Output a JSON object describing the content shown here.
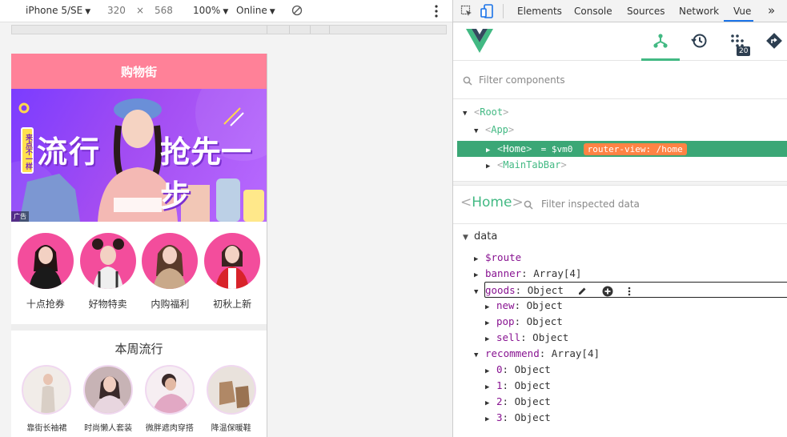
{
  "device_toolbar": {
    "device": "iPhone 5/SE",
    "width": "320",
    "times": "×",
    "height": "568",
    "zoom": "100%",
    "network": "Online"
  },
  "phone": {
    "nav_title": "购物街",
    "banner": {
      "tag": "来点不一样",
      "left_text": "流行",
      "right_text": "抢先一步",
      "ad_label": "广告"
    },
    "recommend": [
      {
        "label": "十点抢券"
      },
      {
        "label": "好物特卖"
      },
      {
        "label": "内购福利"
      },
      {
        "label": "初秋上新"
      }
    ],
    "weekly_title": "本周流行",
    "weekly": [
      {
        "label": "靠街长袖裙"
      },
      {
        "label": "时尚懒人套装"
      },
      {
        "label": "微胖遮肉穿搭"
      },
      {
        "label": "降温保暖鞋"
      }
    ]
  },
  "devtools": {
    "tabs": [
      "Elements",
      "Console",
      "Sources",
      "Network",
      "Vue"
    ],
    "active_tab": "Vue",
    "more": "»",
    "vue_toolbar": {
      "badge": "20"
    },
    "filter_components_placeholder": "Filter components",
    "tree": {
      "root": "Root",
      "app": "App",
      "home": "Home",
      "home_suffix": "= $vm0",
      "router_badge": "router-view: /home",
      "tabbar": "MainTabBar"
    },
    "inspect": {
      "name": "Home",
      "filter_placeholder": "Filter inspected data"
    },
    "data": {
      "section": "data",
      "rows": [
        {
          "key": "$route",
          "value": ""
        },
        {
          "key": "banner",
          "value": "Array[4]"
        },
        {
          "key": "goods",
          "value": "Object"
        },
        {
          "key": "new",
          "value": "Object"
        },
        {
          "key": "pop",
          "value": "Object"
        },
        {
          "key": "sell",
          "value": "Object"
        },
        {
          "key": "recommend",
          "value": "Array[4]"
        },
        {
          "key": "0",
          "value": "Object"
        },
        {
          "key": "1",
          "value": "Object"
        },
        {
          "key": "2",
          "value": "Object"
        },
        {
          "key": "3",
          "value": "Object"
        }
      ]
    }
  },
  "colors": {
    "vue_green": "#42b983",
    "selected_row": "#3ba776",
    "router_badge": "#ff8344",
    "nav_pink": "#ff8198",
    "key_purple": "#881391"
  },
  "icons": [
    "device-mode-icon",
    "inspect-icon",
    "rotate-icon",
    "more-icon",
    "components-icon",
    "history-icon",
    "vuex-icon",
    "router-icon",
    "search-icon",
    "edit-icon",
    "add-icon"
  ]
}
